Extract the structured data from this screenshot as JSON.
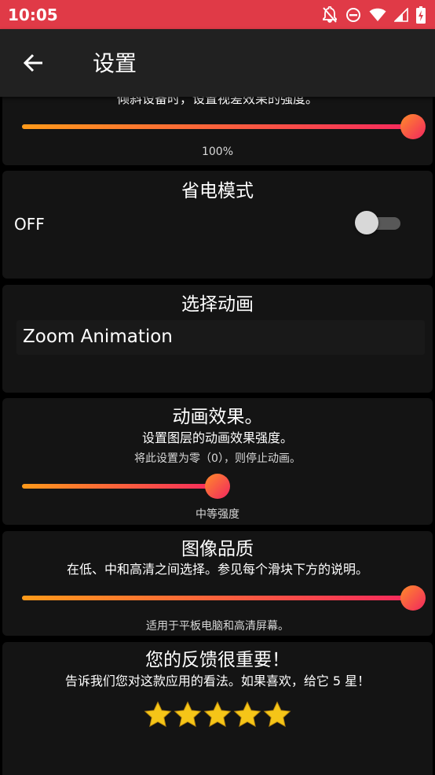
{
  "statusbar": {
    "time": "10:05",
    "background": "#e03a47"
  },
  "appbar": {
    "title": "设置",
    "background": "#212121"
  },
  "parallax": {
    "desc": "倾斜设备时，设置视差效果的强度。",
    "value_text": "100%",
    "level": 1.0
  },
  "battery": {
    "title": "省电模式",
    "state": "OFF",
    "enabled": false
  },
  "animation_select": {
    "title": "选择动画",
    "selected": "Zoom Animation"
  },
  "animation_effect": {
    "title": "动画效果。",
    "desc": "设置图层的动画效果强度。",
    "note": "将此设置为零（0），则停止动画。",
    "value_text": "中等强度",
    "level": 0.5
  },
  "image_quality": {
    "title": "图像品质",
    "desc": "在低、中和高清之间选择。参见每个滑块下方的说明。",
    "value_text": "适用于平板电脑和高清屏幕。",
    "level": 1.0
  },
  "feedback": {
    "title": "您的反馈很重要！",
    "desc": "告诉我们您对这款应用的看法。如果喜欢，给它 5 星！",
    "rating": 5,
    "max_rating": 5
  },
  "colors": {
    "accent_start": "#ff9a1a",
    "accent_end": "#f7295e",
    "star": "#f5c518",
    "card": "#141414"
  }
}
